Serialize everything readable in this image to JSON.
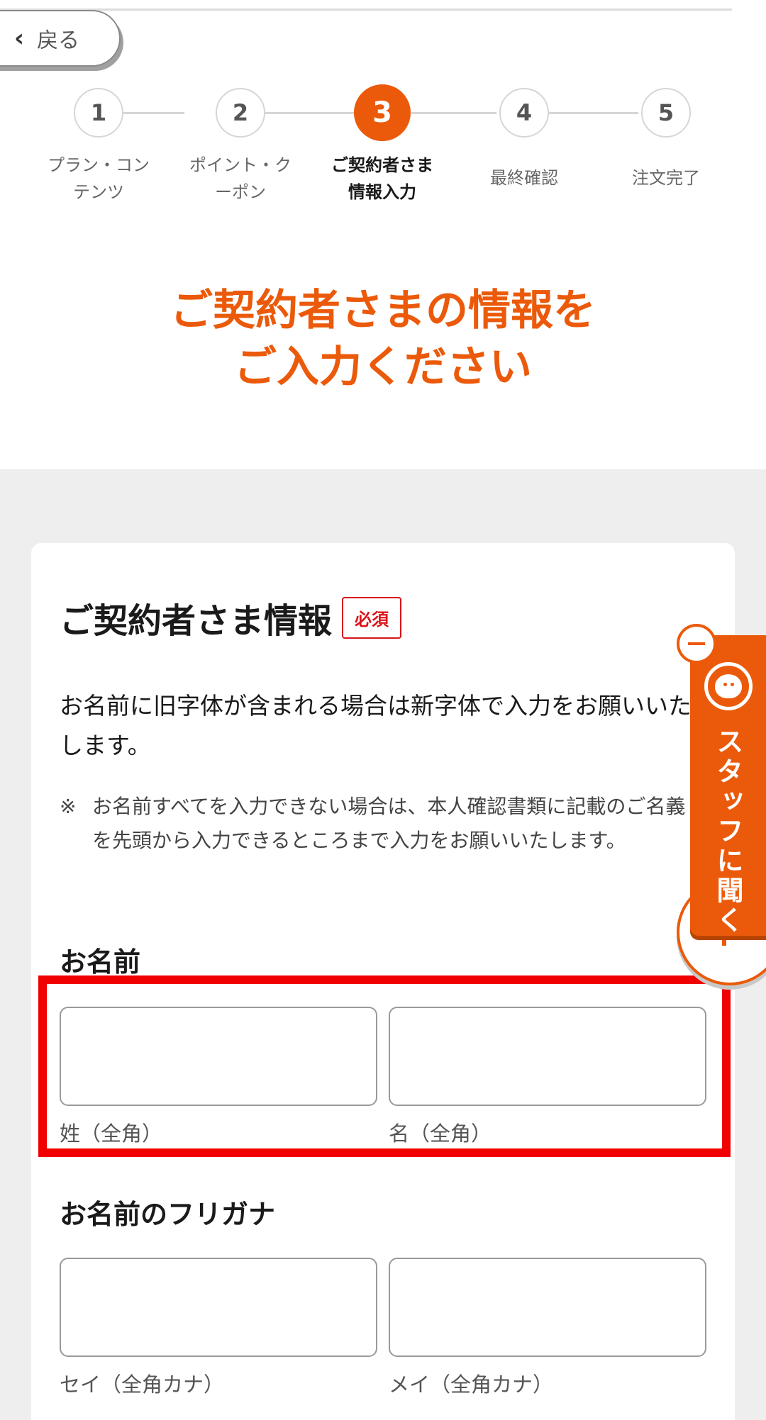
{
  "back": {
    "label": "戻る"
  },
  "steps": [
    {
      "number": "1",
      "label": "プラン・コン\nテンツ"
    },
    {
      "number": "2",
      "label": "ポイント・ク\nーポン"
    },
    {
      "number": "3",
      "label": "ご契約者さま\n情報入力"
    },
    {
      "number": "4",
      "label": "最終確認"
    },
    {
      "number": "5",
      "label": "注文完了"
    }
  ],
  "active_step": 3,
  "heading": {
    "line1": "ご契約者さまの情報を",
    "line2": "ご入力ください"
  },
  "section": {
    "title": "ご契約者さま情報",
    "required_badge": "必須",
    "notice": "お名前に旧字体が含まれる場合は新字体で入力をお願いいたします。",
    "note_mark": "※",
    "note": "お名前すべてを入力できない場合は、本人確認書類に記載のご名義を先頭から入力できるところまで入力をお願いいたします。"
  },
  "name_field": {
    "label": "お名前",
    "last_caption": "姓（全角）",
    "first_caption": "名（全角）",
    "last_value": "",
    "first_value": ""
  },
  "kana_field": {
    "label": "お名前のフリガナ",
    "last_caption": "セイ（全角カナ）",
    "first_caption": "メイ（全角カナ）",
    "last_value": "",
    "first_value": ""
  },
  "chat_widget": {
    "label": "スタッフに聞く",
    "icon": "headset-agent-icon"
  },
  "colors": {
    "accent": "#eb5a0a",
    "required": "#d9141a",
    "highlight": "#f00000"
  }
}
